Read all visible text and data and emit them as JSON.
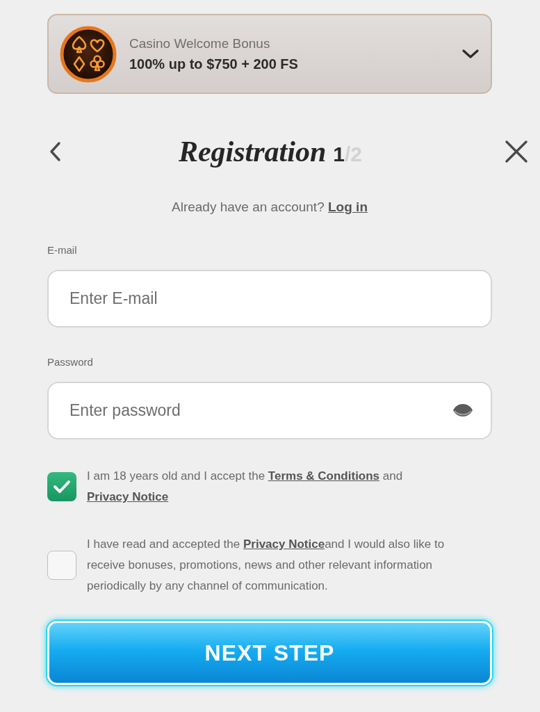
{
  "bonus_banner": {
    "title": "Casino Welcome Bonus",
    "offer": "100% up to $750 + 200 FS",
    "expanded": false
  },
  "header": {
    "title": "Registration",
    "step_current": "1",
    "step_total": "/2"
  },
  "login_prompt": {
    "text": "Already have an account?",
    "link": "Log in"
  },
  "fields": [
    {
      "kind": "email",
      "label": "E-mail",
      "placeholder": "Enter E-mail"
    },
    {
      "kind": "password",
      "label": "Password",
      "placeholder": "Enter password"
    }
  ],
  "consents": [
    {
      "checked": true,
      "parts": [
        {
          "kind": "text",
          "text": "I am 18 years old and I accept the "
        },
        {
          "kind": "link",
          "text": "Terms & Conditions"
        },
        {
          "kind": "text",
          "text": " and "
        },
        {
          "kind": "link",
          "text": "Privacy Notice"
        }
      ]
    },
    {
      "checked": false,
      "parts": [
        {
          "kind": "text",
          "text": "I have read and accepted the "
        },
        {
          "kind": "link",
          "text": "Privacy Notice"
        },
        {
          "kind": "text",
          "text": "and I would also like to receive bonuses, promotions, news and other relevant information periodically by any channel of communication."
        }
      ]
    }
  ],
  "submit_button": {
    "label": "NEXT STEP"
  }
}
